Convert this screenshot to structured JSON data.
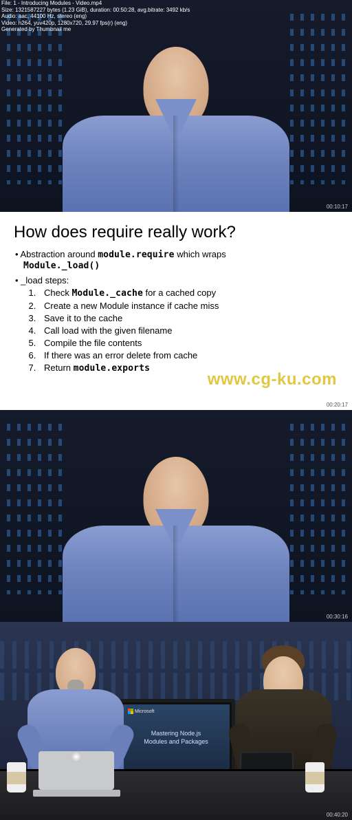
{
  "metadata": {
    "file": "File: 1 - Introducing Modules - Video.mp4",
    "size": "Size: 1321587227 bytes (1.23 GiB), duration: 00:50:28, avg.bitrate: 3492 kb/s",
    "audio": "Audio: aac, 44100 Hz, stereo (eng)",
    "video": "Video: h264, yuv420p, 1280x720, 29.97 fps(r) (eng)",
    "generated": "Generated by Thumbnail me"
  },
  "timestamps": {
    "t1": "00:10:17",
    "t2": "00:20:17",
    "t3": "00:30:16",
    "t4": "00:40:20"
  },
  "slide": {
    "title": "How does require really work?",
    "bullet1_a": "Abstraction around ",
    "bullet1_code1": "module.require",
    "bullet1_b": " which wraps ",
    "bullet1_code2": "Module._load()",
    "bullet2": "_load steps:",
    "step1_a": "Check ",
    "step1_code": "Module._cache",
    "step1_b": "  for a cached copy",
    "step2": "Create a new Module instance if cache miss",
    "step3": "Save it to the cache",
    "step4": "Call load with the given filename",
    "step5": "Compile the file contents",
    "step6": "If there was an error delete from cache",
    "step7_a": "Return ",
    "step7_code": "module.exports"
  },
  "monitor": {
    "brand": "Microsoft",
    "line1": "Mastering Node.js",
    "line2": "Modules and Packages"
  },
  "watermark": "www.cg-ku.com"
}
